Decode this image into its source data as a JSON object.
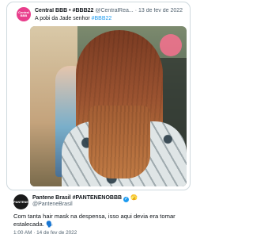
{
  "quoted_tweet": {
    "avatar_text": "Central BBB",
    "display_name": "Central BBB • #BBB22",
    "handle": "@CentralRea...",
    "separator": "·",
    "date": "13 de fev de 2022",
    "text_prefix": "A pobi da Jade senhor ",
    "hashtag": "#BBB22"
  },
  "main_tweet": {
    "avatar_text": "PANTENE",
    "display_name": "Pantene Brasil #PANTENENOBBB",
    "verified_glyph": "✓",
    "badge_emoji": "🫣",
    "handle": "@PanteneBrasil",
    "text": "Com tanta hair mask na despensa, isso aqui devia era tomar estalecada. 🗣️",
    "timestamp": "1:00 AM · 14 de fev de 2022"
  },
  "colors": {
    "link": "#1d9bf0",
    "text": "#0f1419",
    "muted": "#536471",
    "border": "#cfd9de"
  },
  "icons": [
    "verified-badge-icon"
  ]
}
